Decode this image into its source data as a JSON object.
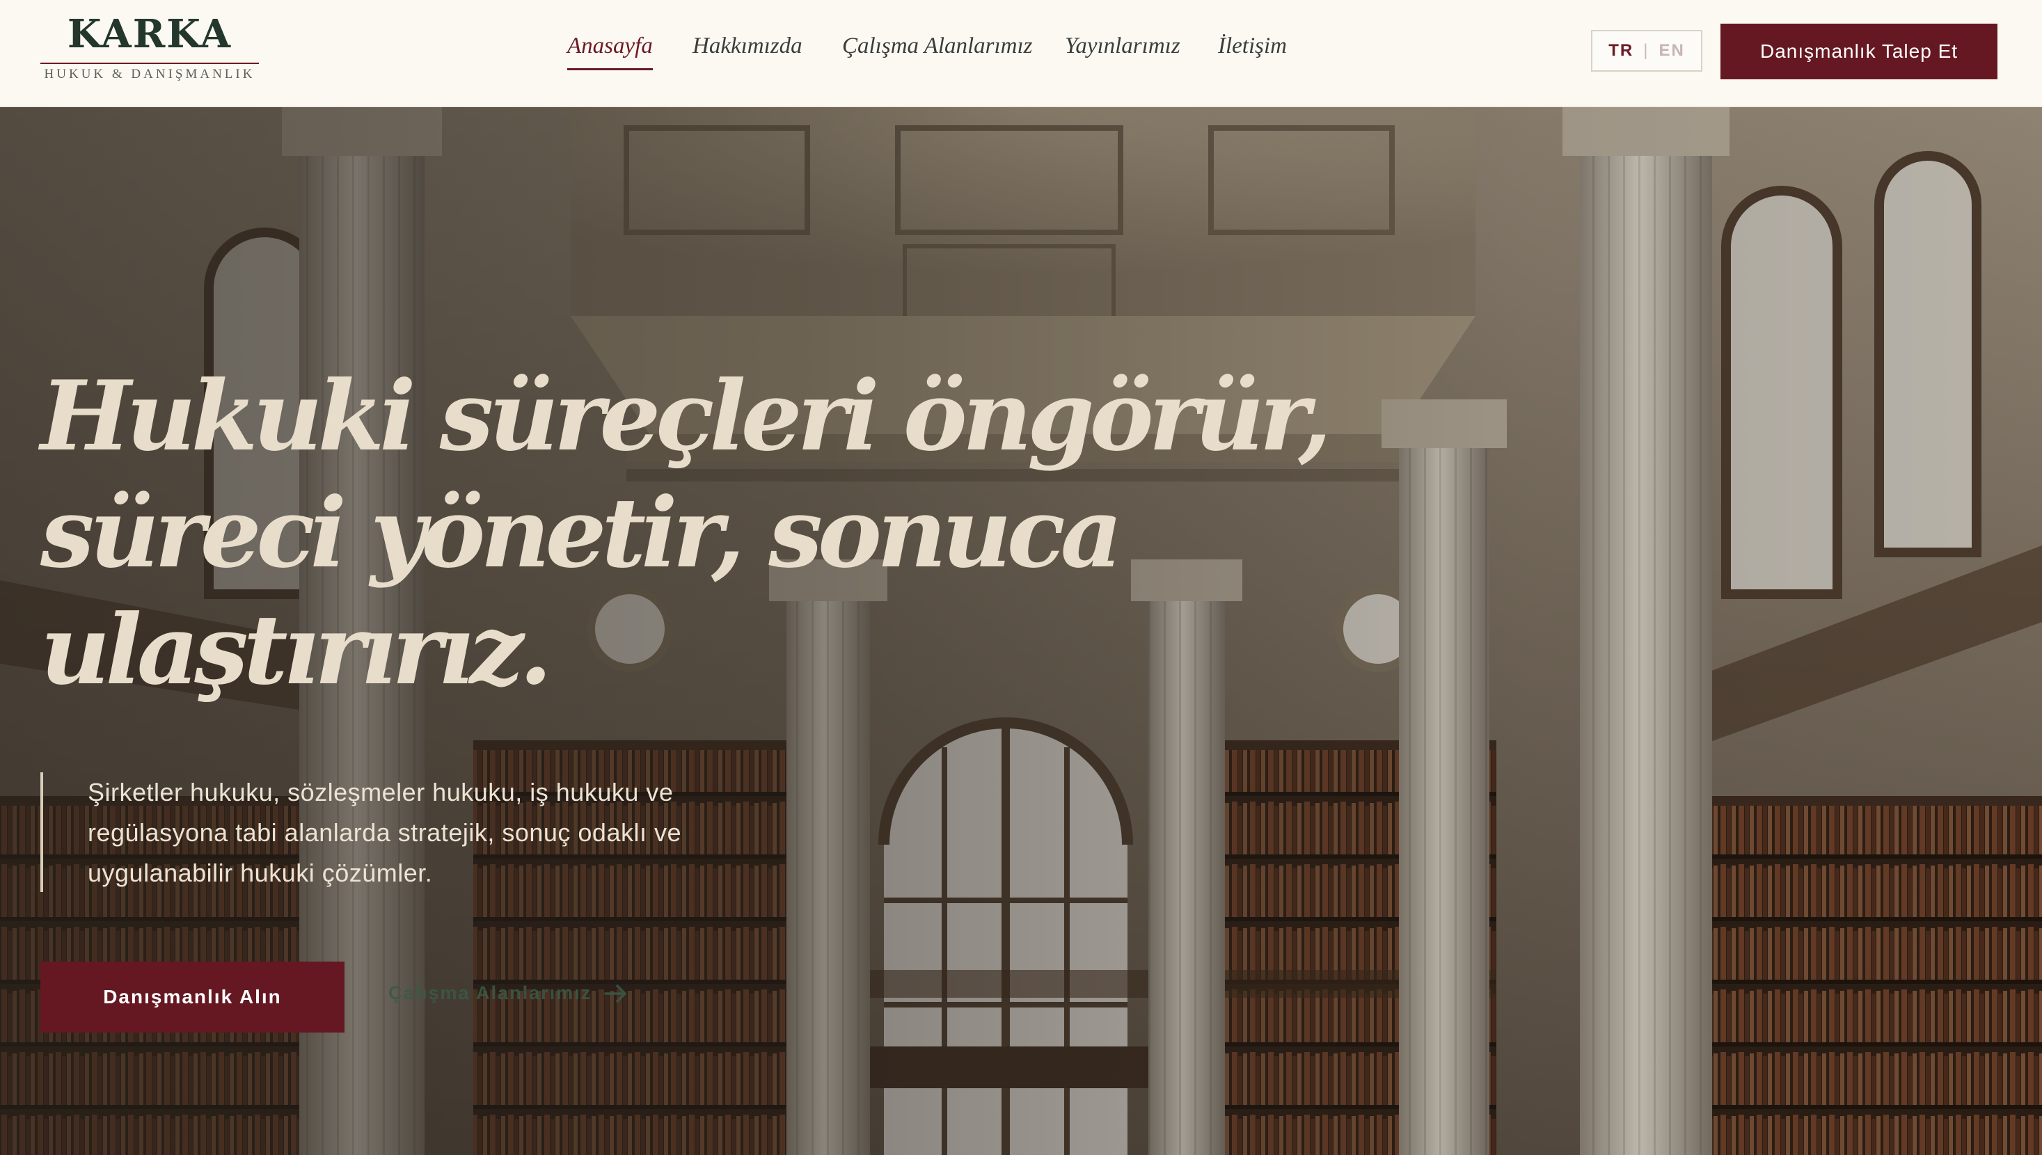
{
  "brand": {
    "name": "KARKA",
    "tagline": "HUKUK & DANIŞMANLIK"
  },
  "nav": {
    "items": [
      {
        "label": "Anasayfa",
        "active": true
      },
      {
        "label": "Hakkımızda",
        "active": false
      },
      {
        "label": "Çalışma Alanlarımız",
        "active": false
      },
      {
        "label": "Yayınlarımız",
        "active": false
      },
      {
        "label": "İletişim",
        "active": false
      }
    ]
  },
  "language": {
    "tr": "TR",
    "separator": "|",
    "en": "EN",
    "selected": "TR"
  },
  "header_cta": {
    "label": "Danışmanlık Talep Et"
  },
  "hero": {
    "headline": [
      "Hukuki süreçleri öngörür,",
      "süreci yönetir, sonuca",
      "ulaştırırız."
    ],
    "lead": "Şirketler hukuku, sözleşmeler hukuku, iş hukuku ve regülasyona tabi alanlarda stratejik, sonuç odaklı ve uygulanabilir hukuki çözümler.",
    "primary_cta": "Danışmanlık Alın",
    "secondary_cta": "Çalışma Alanlarımız",
    "secondary_icon": "arrow-right-icon"
  },
  "colors": {
    "brand": "#651822",
    "logo": "#23372c",
    "headline": "#e7ddca",
    "header_bg": "#fcf9f3"
  }
}
